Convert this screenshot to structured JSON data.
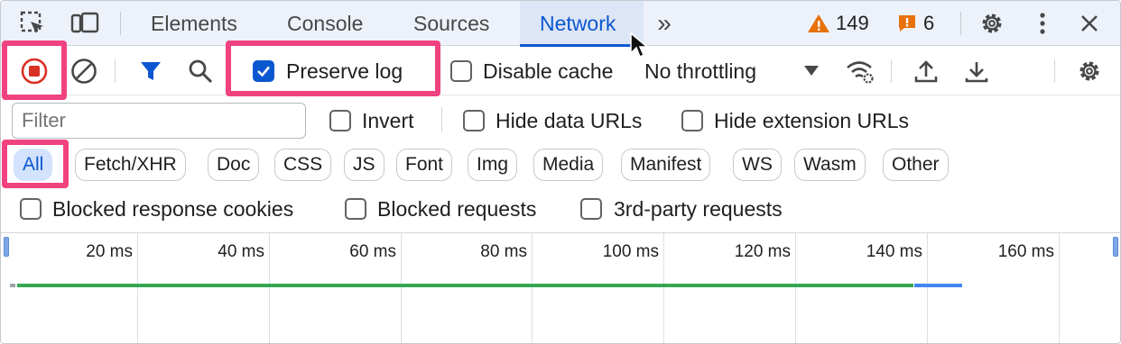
{
  "tabs": {
    "items": [
      "Elements",
      "Console",
      "Sources",
      "Network"
    ],
    "active": "Network",
    "more": "»"
  },
  "status": {
    "warnings": "149",
    "issues": "6"
  },
  "toolbar": {
    "preserve_log": "Preserve log",
    "preserve_log_checked": true,
    "disable_cache": "Disable cache",
    "disable_cache_checked": false,
    "throttling": "No throttling"
  },
  "filter": {
    "placeholder": "Filter",
    "invert": "Invert",
    "hide_data_urls": "Hide data URLs",
    "hide_extension_urls": "Hide extension URLs"
  },
  "types": [
    "All",
    "Fetch/XHR",
    "Doc",
    "CSS",
    "JS",
    "Font",
    "Img",
    "Media",
    "Manifest",
    "WS",
    "Wasm",
    "Other"
  ],
  "active_type": "All",
  "request_filters": {
    "blocked_cookies": "Blocked response cookies",
    "blocked_requests": "Blocked requests",
    "third_party": "3rd-party requests"
  },
  "timeline": {
    "ticks": [
      "20 ms",
      "40 ms",
      "60 ms",
      "80 ms",
      "100 ms",
      "120 ms",
      "140 ms",
      "160 ms"
    ]
  },
  "colors": {
    "accent": "#0b57d0",
    "record": "#d93025",
    "highlight": "#f0427f",
    "warning": "#e8710a",
    "timing_green": "#34a853",
    "timing_blue": "#4285f4"
  }
}
